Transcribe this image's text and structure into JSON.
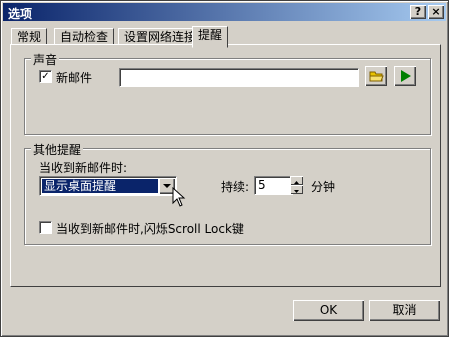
{
  "window": {
    "title": "选项"
  },
  "titlebar_buttons": {
    "help": "?",
    "close": "×"
  },
  "tabs": [
    {
      "label": "常规",
      "active": false
    },
    {
      "label": "自动检查",
      "active": false
    },
    {
      "label": "设置网络连接",
      "active": false
    },
    {
      "label": "提醒",
      "active": true
    }
  ],
  "sound": {
    "legend": "声音",
    "new_mail_checkbox": {
      "label": "新邮件",
      "checked": true
    },
    "sound_path": {
      "value": ""
    },
    "icons": {
      "browse": "folder-icon",
      "play": "play-icon"
    },
    "colors": {
      "play": "#008000",
      "folder": "#e8c200"
    }
  },
  "other": {
    "legend": "其他提醒",
    "when_new_mail_label": "当收到新邮件时:",
    "action_select": {
      "value": "显示桌面提醒"
    },
    "duration_label": "持续:",
    "duration_value": "5",
    "duration_unit": "分钟",
    "scroll_lock_checkbox": {
      "label": "当收到新邮件时,闪烁Scroll Lock键",
      "checked": false
    }
  },
  "buttons": {
    "ok": "OK",
    "cancel": "取消"
  }
}
